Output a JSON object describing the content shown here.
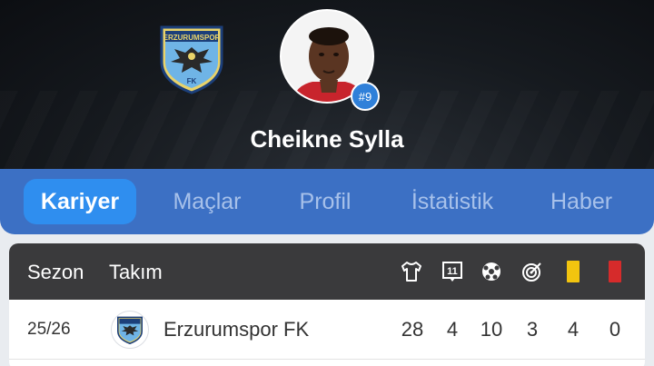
{
  "player": {
    "name": "Cheikne Sylla",
    "number": "#9",
    "club_logo_text": "ERZURUMSPOR",
    "club_logo_sub": "FK"
  },
  "tabs": [
    {
      "label": "Kariyer",
      "active": true
    },
    {
      "label": "Maçlar",
      "active": false
    },
    {
      "label": "Profil",
      "active": false
    },
    {
      "label": "İstatistik",
      "active": false
    },
    {
      "label": "Haber",
      "active": false
    }
  ],
  "table": {
    "headers": {
      "season": "Sezon",
      "team": "Takım",
      "icons": [
        "shirt-icon",
        "substitute-icon",
        "ball-icon",
        "target-icon",
        "yellow-card-icon",
        "red-card-icon"
      ]
    },
    "rows": [
      {
        "season": "25/26",
        "team": "Erzurumspor FK",
        "stats": [
          "28",
          "4",
          "10",
          "3",
          "4",
          "0"
        ]
      }
    ]
  },
  "colors": {
    "tabbar": "#3c70c4",
    "tab_active": "#2f8eef",
    "header_dark": "#3a3a3c",
    "yellow_card": "#f2c40f",
    "red_card": "#d62b2b"
  }
}
